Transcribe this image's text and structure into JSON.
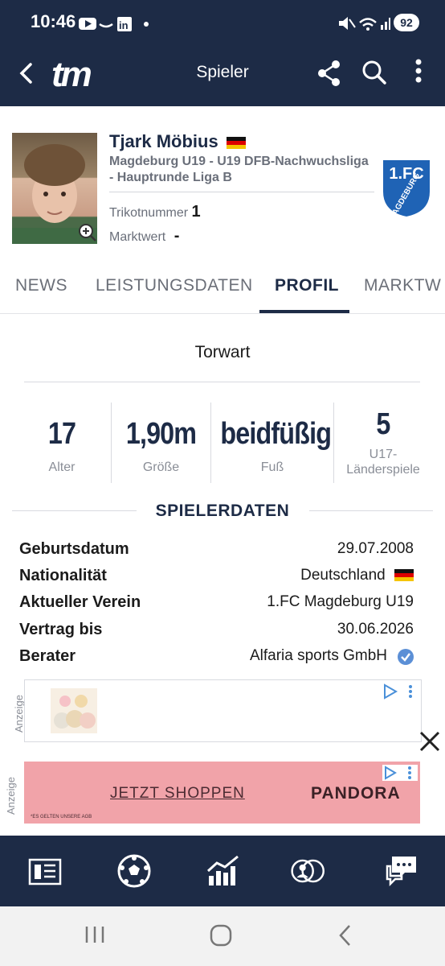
{
  "status_bar": {
    "time": "10:46",
    "battery": "92"
  },
  "app_bar": {
    "logo": "tm",
    "title": "Spieler"
  },
  "player": {
    "name": "Tjark Möbius",
    "league": "Magdeburg U19 - U19 DFB-Nachwuchsliga - Hauptrunde Liga B",
    "shirt_label": "Trikotnummer",
    "shirt_value": "1",
    "market_label": "Marktwert",
    "market_value": "-",
    "club_badge_text_line1": "1.FC",
    "club_badge_text_line2": "MAGDEBURG"
  },
  "tabs": [
    {
      "label": "NEWS",
      "active": false
    },
    {
      "label": "LEISTUNGSDATEN",
      "active": false
    },
    {
      "label": "PROFIL",
      "active": true
    },
    {
      "label": "MARKTW",
      "active": false
    }
  ],
  "position": "Torwart",
  "facts": [
    {
      "value": "17",
      "label": "Alter"
    },
    {
      "value": "1,90m",
      "label": "Größe"
    },
    {
      "value": "beidfüßig",
      "label": "Fuß"
    },
    {
      "value": "5",
      "label": "U17-\nLänderspiele"
    }
  ],
  "section_title": "SPIELERDATEN",
  "details": [
    {
      "label": "Geburtsdatum",
      "value": "29.07.2008"
    },
    {
      "label": "Nationalität",
      "value": "Deutschland"
    },
    {
      "label": "Aktueller Verein",
      "value": "1.FC Magdeburg U19"
    },
    {
      "label": "Vertrag bis",
      "value": "30.06.2026"
    },
    {
      "label": "Berater",
      "value": "Alfaria sports GmbH"
    }
  ],
  "ads": {
    "label": "Anzeige",
    "ad2_cta": "JETZT SHOPPEN",
    "ad2_brand": "PANDORA",
    "ad2_footnote": "*ES GELTEN UNSERE AGB"
  },
  "colors": {
    "navy": "#1d2b46",
    "verified": "#5b8fd6",
    "ad_pink": "#f1a3a9"
  }
}
